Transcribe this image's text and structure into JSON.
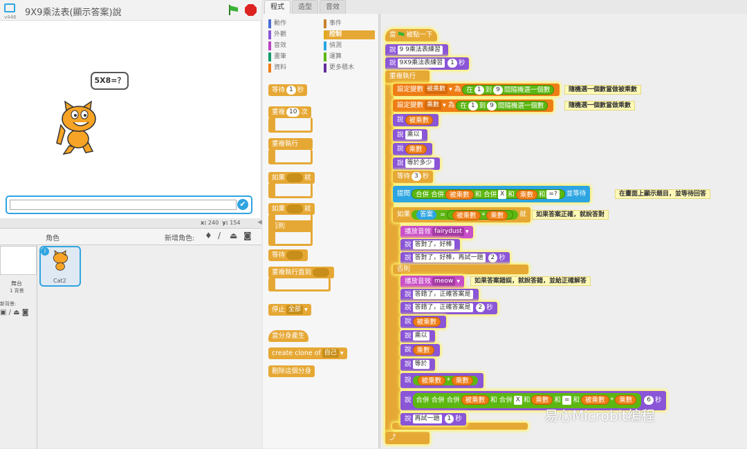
{
  "header": {
    "version": "v446",
    "title": "9X9乘法表(顯示答案)說"
  },
  "stage": {
    "bubble": "5X8=？",
    "coords_x_label": "x:",
    "coords_x": "240",
    "coords_y_label": "y:",
    "coords_y": "154"
  },
  "sprite_panel": {
    "title": "角色",
    "new_sprite": "新增角色:",
    "stage_label": "舞台",
    "stage_sub": "1 背景",
    "new_backdrop": "新背景:",
    "sprite_name": "Cat2"
  },
  "tabs": [
    "程式",
    "造型",
    "音效"
  ],
  "categories": [
    {
      "label": "動作",
      "color": "#4a6cd4"
    },
    {
      "label": "事件",
      "color": "#c88330"
    },
    {
      "label": "外觀",
      "color": "#8a55d7"
    },
    {
      "label": "控制",
      "color": "#e1a91a"
    },
    {
      "label": "音效",
      "color": "#bb42c3"
    },
    {
      "label": "偵測",
      "color": "#2ca5e2"
    },
    {
      "label": "畫筆",
      "color": "#0e9a6c"
    },
    {
      "label": "運算",
      "color": "#5cb712"
    },
    {
      "label": "資料",
      "color": "#ee7d16"
    },
    {
      "label": "更多積木",
      "color": "#632d99"
    }
  ],
  "palette": {
    "wait": "等待",
    "wait_n": "1",
    "wait_unit": "秒",
    "repeat": "重複",
    "repeat_n": "10",
    "repeat_unit": "次",
    "forever": "重複執行",
    "if": "如果",
    "then": "就",
    "else": "否則",
    "wait_until": "等待",
    "repeat_until": "重複執行直到",
    "stop": "停止",
    "stop_opt": "全部",
    "clone_start": "當分身產生",
    "create_clone": "create clone of",
    "clone_opt": "自己",
    "delete_clone": "刪除這個分身"
  },
  "script": {
    "hat": "當",
    "hat_tail": "被點一下",
    "say": "說",
    "say1": "9 9乘法表練習",
    "say2": "9X9乘法表練習",
    "say2_n": "1",
    "secs": "秒",
    "forever": "重複執行",
    "set": "設定變數",
    "var_a": "被乘數",
    "var_b": "乘數",
    "to": "為",
    "pick": "在",
    "to2": "到",
    "pick_tail": "間隨機選一個數",
    "n1": "1",
    "n9": "9",
    "cmt1": "隨機選一個數當做被乘數",
    "cmt2": "隨機選一個數當做乘數",
    "times": "乘以",
    "equals": "等於多少",
    "equals_short": "等於",
    "wait": "等待",
    "wait_n": "3",
    "ask": "提問",
    "join": "合併",
    "and": "和",
    "x": "X",
    "eq": "=?",
    "ask_tail": "並等待",
    "cmt3": "在畫面上顯示題目，並等待回答",
    "if": "如果",
    "answer": "答案",
    "op_eq": "=",
    "op_mul": "*",
    "then": "就",
    "cmt4": "如果答案正確，就說答對",
    "play": "播放音效",
    "snd1": "fairydust",
    "snd2": "meow",
    "right1": "答對了，好棒",
    "right2": "答對了，好棒，再試一題",
    "right2_n": "2",
    "else": "否則",
    "cmt5": "如果答案錯誤，就說答錯，並給正確解答",
    "wrong1": "答錯了，正確答案是",
    "wrong2": "答錯了，正確答案是",
    "wrong2_n": "2",
    "eqsign": "=",
    "final_n": "6",
    "again": "再試一題",
    "again_n": "1"
  },
  "watermark": "易心Microbit编程"
}
